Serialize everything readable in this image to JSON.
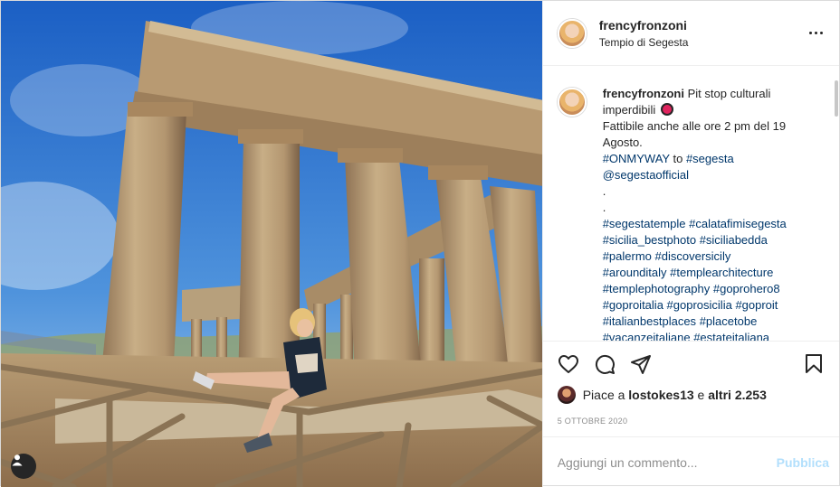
{
  "post": {
    "username": "frencyfronzoni",
    "location": "Tempio di Segesta",
    "caption": {
      "username": "frencyfronzoni",
      "line1": "Pit stop culturali imperdibili",
      "line2": "Fattibile anche alle ore 2 pm del 19 Agosto.",
      "onmyway": "#ONMYWAY",
      "to": " to ",
      "segesta_tag": "#segesta",
      "mention": "@segestaofficial",
      "dot1": ".",
      "dot2": ".",
      "hashtags": [
        [
          "#segestatemple",
          "#calatafimisegesta"
        ],
        [
          "#sicilia_bestphoto",
          "#siciliabedda"
        ],
        [
          "#palermo",
          "#discoversicily"
        ],
        [
          "#arounditaly",
          "#templearchitecture"
        ],
        [
          "#templephotography",
          "#goprohero8"
        ],
        [
          "#goproitalia",
          "#goprosicilia",
          "#goproit"
        ],
        [
          "#italianbestplaces",
          "#placetobe"
        ],
        [
          "#vacanzeitaliane",
          "#estateitaliana"
        ]
      ]
    },
    "likes": {
      "prefix": "Piace a ",
      "user": "lostokes13",
      "middle": " e ",
      "others": "altri 2.253"
    },
    "date": "5 OTTOBRE 2020",
    "comment_placeholder": "Aggiungi un commento...",
    "publish_label": "Pubblica"
  },
  "icons": {
    "like": "heart-icon",
    "comment": "comment-icon",
    "share": "paper-plane-icon",
    "save": "bookmark-icon",
    "more": "more-options-icon",
    "tag": "user-tag-icon"
  },
  "colors": {
    "link": "#00376b",
    "publish_disabled": "#b2dffc",
    "secondary_text": "#8e8e8e",
    "border": "#dbdbdb"
  }
}
